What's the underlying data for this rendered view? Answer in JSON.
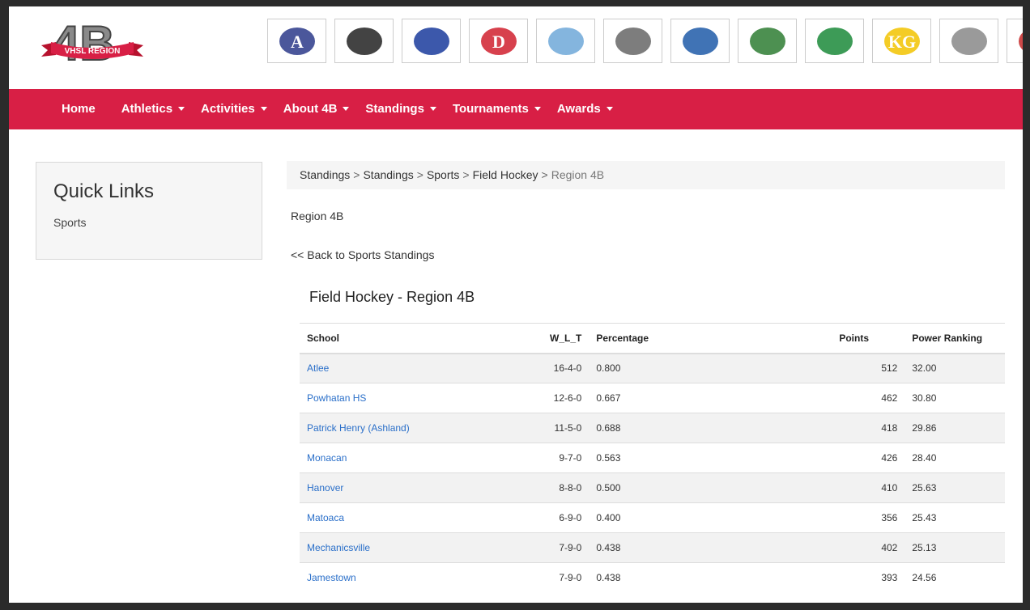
{
  "header": {
    "logo_text_big": "4B",
    "logo_ribbon": "VHSL REGION",
    "team_logos": [
      {
        "name": "atlee-logo",
        "letter": "A",
        "color": "#2b3a8a"
      },
      {
        "name": "knight-logo",
        "letter": "",
        "color": "#222222"
      },
      {
        "name": "paw-logo",
        "letter": "",
        "color": "#1a3b9c"
      },
      {
        "name": "d-logo",
        "letter": "D",
        "color": "#d0202e"
      },
      {
        "name": "tornado-logo",
        "letter": "",
        "color": "#6fa8d8"
      },
      {
        "name": "bulldog-logo",
        "letter": "",
        "color": "#666666"
      },
      {
        "name": "hawk-logo",
        "letter": "",
        "color": "#1e5aa8"
      },
      {
        "name": "patriot-logo",
        "letter": "",
        "color": "#2e7d32"
      },
      {
        "name": "falcon-logo",
        "letter": "",
        "color": "#1b8a3a"
      },
      {
        "name": "kg-logo",
        "letter": "KG",
        "color": "#f2c300"
      },
      {
        "name": "mustang-logo",
        "letter": "",
        "color": "#888888"
      },
      {
        "name": "partial-logo",
        "letter": "",
        "color": "#c62828"
      }
    ]
  },
  "nav": {
    "items": [
      {
        "label": "Home",
        "dropdown": false
      },
      {
        "label": "Athletics",
        "dropdown": true
      },
      {
        "label": "Activities",
        "dropdown": true
      },
      {
        "label": "About 4B",
        "dropdown": true
      },
      {
        "label": "Standings",
        "dropdown": true
      },
      {
        "label": "Tournaments",
        "dropdown": true
      },
      {
        "label": "Awards",
        "dropdown": true
      }
    ]
  },
  "sidebar": {
    "title": "Quick Links",
    "links": [
      "Sports"
    ]
  },
  "breadcrumb": {
    "items": [
      "Standings",
      "Standings",
      "Sports",
      "Field Hockey"
    ],
    "current": "Region 4B",
    "separator": ">"
  },
  "main": {
    "region_label": "Region 4B",
    "back_link": "<< Back to Sports Standings",
    "table_title": "Field Hockey - Region 4B"
  },
  "table": {
    "headers": {
      "school": "School",
      "wlt": "W_L_T",
      "percentage": "Percentage",
      "points": "Points",
      "power": "Power Ranking"
    },
    "rows": [
      {
        "school": "Atlee",
        "wlt": "16-4-0",
        "percentage": "0.800",
        "points": "512",
        "power": "32.00"
      },
      {
        "school": "Powhatan HS",
        "wlt": "12-6-0",
        "percentage": "0.667",
        "points": "462",
        "power": "30.80"
      },
      {
        "school": "Patrick Henry (Ashland)",
        "wlt": "11-5-0",
        "percentage": "0.688",
        "points": "418",
        "power": "29.86"
      },
      {
        "school": "Monacan",
        "wlt": "9-7-0",
        "percentage": "0.563",
        "points": "426",
        "power": "28.40"
      },
      {
        "school": "Hanover",
        "wlt": "8-8-0",
        "percentage": "0.500",
        "points": "410",
        "power": "25.63"
      },
      {
        "school": "Matoaca",
        "wlt": "6-9-0",
        "percentage": "0.400",
        "points": "356",
        "power": "25.43"
      },
      {
        "school": "Mechanicsville",
        "wlt": "7-9-0",
        "percentage": "0.438",
        "points": "402",
        "power": "25.13"
      },
      {
        "school": "Jamestown",
        "wlt": "7-9-0",
        "percentage": "0.438",
        "points": "393",
        "power": "24.56"
      }
    ]
  }
}
